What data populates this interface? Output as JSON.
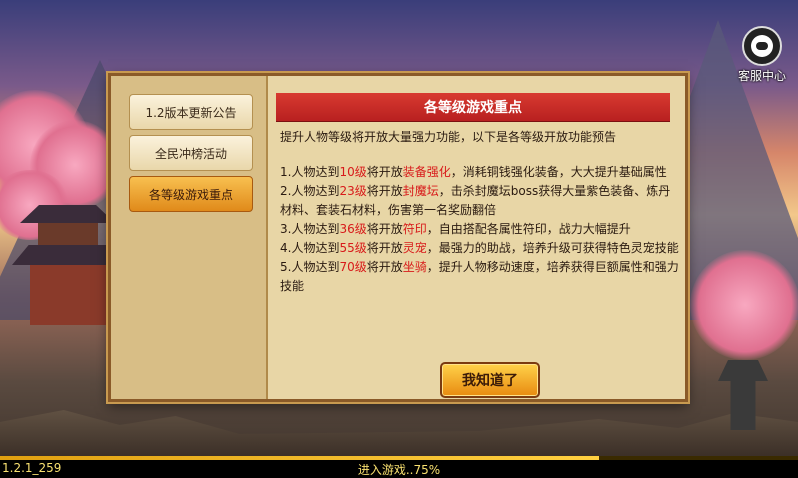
{
  "service": {
    "label": "客服中心",
    "icon": "headset-icon"
  },
  "dialog": {
    "tabs": [
      {
        "label": "1.2版本更新公告",
        "active": false
      },
      {
        "label": "全民冲榜活动",
        "active": false
      },
      {
        "label": "各等级游戏重点",
        "active": true
      }
    ],
    "banner": "各等级游戏重点",
    "intro": "提升人物等级将开放大量强力功能，以下是各等级开放功能预告",
    "items": [
      {
        "prefix": "1.人物达到",
        "level": "10级",
        "mid": "将开放",
        "feature": "装备强化",
        "rest": "，消耗铜钱强化装备，大大提升基础属性"
      },
      {
        "prefix": "2.人物达到",
        "level": "23级",
        "mid": "将开放",
        "feature": "封魔坛",
        "rest": "，击杀封魔坛boss获得大量紫色装备、炼丹材料、套装石材料，伤害第一名奖励翻倍"
      },
      {
        "prefix": "3.人物达到",
        "level": "36级",
        "mid": "将开放",
        "feature": "符印",
        "rest": "，自由搭配各属性符印，战力大幅提升"
      },
      {
        "prefix": "4.人物达到",
        "level": "55级",
        "mid": "将开放",
        "feature": "灵宠",
        "rest": "，最强力的助战，培养升级可获得特色灵宠技能"
      },
      {
        "prefix": "5.人物达到",
        "level": "70级",
        "mid": "将开放",
        "feature": "坐骑",
        "rest": "，提升人物移动速度，培养获得巨额属性和强力技能"
      }
    ],
    "ok_label": "我知道了"
  },
  "status": {
    "version": "1.2.1_259",
    "loading_text": "进入游戏..75%",
    "progress": 0.75
  },
  "colors": {
    "highlight": "#d81a1a",
    "accent": "#e88a10",
    "banner": "#c82a24"
  }
}
